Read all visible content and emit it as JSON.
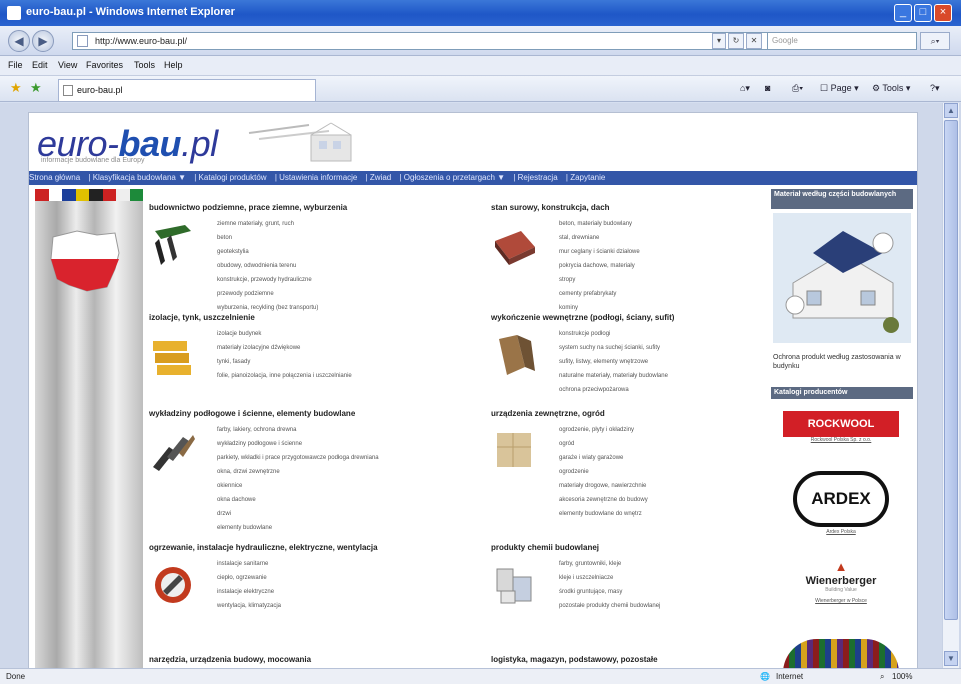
{
  "window": {
    "title": "euro-bau.pl - Windows Internet Explorer"
  },
  "address": {
    "url": "http://www.euro-bau.pl/",
    "search_placeholder": "Google"
  },
  "menu": [
    "File",
    "Edit",
    "View",
    "Favorites",
    "Tools",
    "Help"
  ],
  "tab": {
    "label": "euro-bau.pl"
  },
  "command_bar": {
    "page": "Page",
    "tools": "Tools"
  },
  "site": {
    "logo_prefix": "euro-",
    "logo_bold": "bau",
    "logo_suffix": ".pl",
    "tagline": "informacje budowlane dla Europy",
    "nav": [
      "Strona główna",
      "| Klasyfikacja budowlana ▼",
      "| Katalogi produktów",
      "| Ustawienia informacje",
      "| Zwiad",
      "| Ogłoszenia o przetargach ▼",
      "| Rejestracja",
      "| Zapytanie"
    ]
  },
  "categories": [
    {
      "title": "budownictwo podziemne, prace ziemne, wyburzenia",
      "items": [
        "ziemne materiały, grunt, ruch",
        "beton",
        "geotekstylia",
        "obudowy, odwodnienia terenu",
        "konstrukcje, przewody hydrauliczne",
        "przewody podziemne",
        "wyburzenia, recykling (bez transportu)"
      ]
    },
    {
      "title": "stan surowy, konstrukcja, dach",
      "items": [
        "beton, materiały budowlany",
        "stal, drewniane",
        "mur ceglany i ścianki działowe",
        "pokrycia dachowe, materiały",
        "stropy",
        "cementy prefabrykaty",
        "kominy"
      ]
    },
    {
      "title": "izolacje, tynk, uszczelnienie",
      "items": [
        "izolacje budynek",
        "materiały izolacyjne dźwiękowe",
        "tynki, fasady",
        "folie, pianoizolacja, inne połączenia i uszczelnianie"
      ]
    },
    {
      "title": "wykończenie wewnętrzne (podłogi, ściany, sufit)",
      "items": [
        "konstrukcje podłogi",
        "system suchy na suchej ścianki, sufity",
        "sufity, listwy, elementy wnętrzowe",
        "naturalne materiały, materiały budowlane",
        "ochrona przeciwpożarowa"
      ]
    },
    {
      "title": "wykładziny podłogowe i ścienne, elementy budowlane",
      "items": [
        "farby, lakiery, ochrona drewna",
        "wykładziny podłogowe i ścienne",
        "parkiety, wkładki i prace przygotowawcze podłoga drewniana",
        "okna, drzwi zewnętrzne",
        "okiennice",
        "okna dachowe",
        "drzwi",
        "elementy budowlane"
      ]
    },
    {
      "title": "urządzenia zewnętrzne, ogród",
      "items": [
        "ogrodzenie, płyty i okładziny",
        "ogród",
        "garaże i wiaty garażowe",
        "ogrodzenie",
        "materiały drogowe, nawierzchnie",
        "akcesoria zewnętrzne do budowy",
        "elementy budowlane do wnętrz"
      ]
    },
    {
      "title": "ogrzewanie, instalacje hydrauliczne, elektryczne, wentylacja",
      "items": [
        "instalacje sanitarne",
        "ciepło, ogrzewanie",
        "instalacje elektryczne",
        "wentylacja, klimatyzacja"
      ]
    },
    {
      "title": "produkty chemii budowlanej",
      "items": [
        "farby, gruntowniki, kleje",
        "kleje i uszczelniacze",
        "środki gruntujące, masy",
        "pozostałe produkty chemii budowlanej"
      ]
    },
    {
      "title": "narzędzia, urządzenia budowy, mocowania",
      "items": []
    },
    {
      "title": "logistyka, magazyn, podstawowy, pozostałe",
      "items": []
    }
  ],
  "sidebar": {
    "box1_title": "Materiał według części budowlanych",
    "box1_text": "Ochrona produkt według zastosowania w budynku",
    "box2_title": "Katalogi producentów",
    "brands": [
      {
        "name": "ROCKWOOL",
        "link": "Rockwool Polska Sp. z o.o."
      },
      {
        "name": "ARDEX",
        "link": "Ardex Polska"
      },
      {
        "name": "Wienerberger",
        "link": "Wienerberger w Polsce",
        "sub": "Building Value"
      }
    ]
  },
  "status": {
    "left": "Done",
    "zone": "Internet",
    "zoom": "100%"
  }
}
